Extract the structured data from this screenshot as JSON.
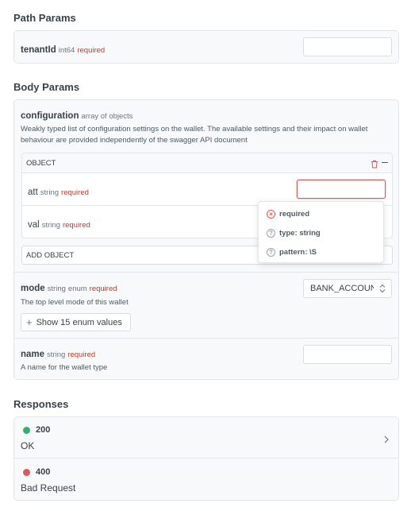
{
  "path_params": {
    "title": "Path Params",
    "tenant": {
      "name": "tenantId",
      "type": "int64",
      "required": "required",
      "value": ""
    }
  },
  "body_params": {
    "title": "Body Params",
    "configuration": {
      "name": "configuration",
      "type": "array of objects",
      "description": "Weakly typed list of configuration settings on the wallet. The available settings and their impact on wallet behaviour are provided independently of the swagger API document",
      "object_label": "OBJECT",
      "att": {
        "name": "att",
        "type": "string",
        "required": "required",
        "value": ""
      },
      "val": {
        "name": "val",
        "type": "string",
        "required": "required"
      },
      "add_object": "ADD OBJECT"
    },
    "validation_popover": {
      "items": [
        "required",
        "type: string",
        "pattern: \\S"
      ]
    },
    "mode": {
      "name": "mode",
      "type": "string",
      "enum": "enum",
      "required": "required",
      "description": "The top level mode of this wallet",
      "selected": "BANK_ACCOUNT",
      "show_enum": "Show 15 enum values"
    },
    "name_field": {
      "name": "name",
      "type": "string",
      "required": "required",
      "description": "A name for the wallet type",
      "value": ""
    }
  },
  "responses": {
    "title": "Responses",
    "items": [
      {
        "code": "200",
        "label": "OK",
        "color": "#2fb36b"
      },
      {
        "code": "400",
        "label": "Bad Request",
        "color": "#e05757"
      }
    ]
  }
}
